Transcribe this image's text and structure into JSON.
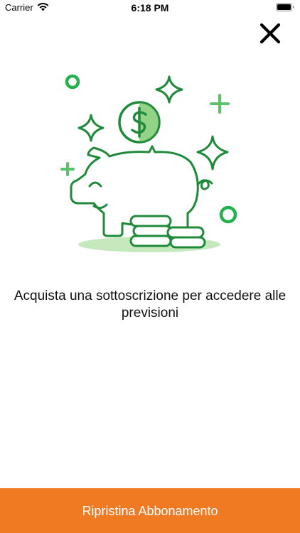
{
  "status_bar": {
    "carrier": "Carrier",
    "time": "6:18 PM",
    "wifi_icon": "wifi-icon",
    "battery_icon": "battery-icon"
  },
  "close_icon": "close-icon",
  "illustration": {
    "icon": "piggy-bank-icon",
    "accent_color": "#2E8B3C",
    "light_color": "#8BD17C"
  },
  "message": "Acquista una sottoscrizione per accedere alle previsioni",
  "restore_button": {
    "label": "Ripristina Abbonamento",
    "color": "#F07A21"
  }
}
